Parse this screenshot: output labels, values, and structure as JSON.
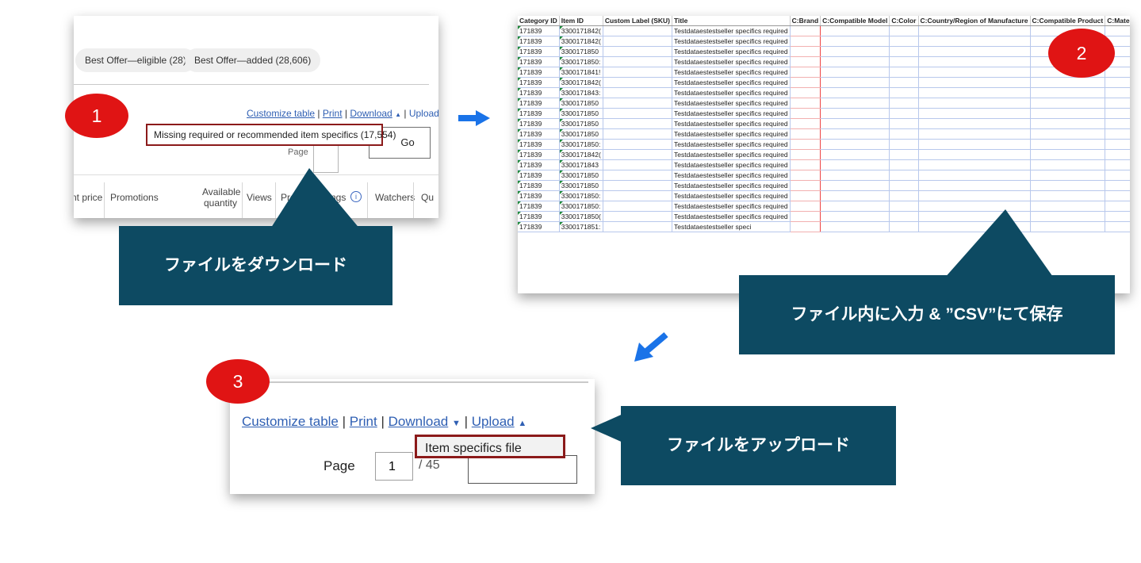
{
  "step1": {
    "badge": "1",
    "filters": {
      "best_offer_eligible": "Best Offer—eligible (28)",
      "best_offer_added": "Best Offer—added (28,606)"
    },
    "links": {
      "customize": "Customize table",
      "print": "Print",
      "download": "Download",
      "upload": "Upload",
      "sep": "|"
    },
    "dropdown_item": "Missing required or recommended item specifics (17,554)",
    "page_label": "Page",
    "go_label": "Go",
    "columns": {
      "price": "nt price",
      "promotions": "Promotions",
      "available_1": "Available",
      "available_2": "quantity",
      "views": "Views",
      "promoted": "Pro",
      "listings": "ngs",
      "watchers": "Watchers",
      "qty": "Qu"
    },
    "callout": "ファイルをダウンロード"
  },
  "step2": {
    "badge": "2",
    "headers": [
      "Category ID",
      "Item ID",
      "Custom Label (SKU)",
      "Title",
      "C:Brand",
      "C:Compatible Model",
      "C:Color",
      "C:Country/Region of Manufacture",
      "C:Compatible Product",
      "C:Material"
    ],
    "rows": [
      {
        "category": "171839",
        "item": "3300171842(",
        "title": "Testdataestestseller specifics required"
      },
      {
        "category": "171839",
        "item": "3300171842(",
        "title": "Testdataestestseller specifics required"
      },
      {
        "category": "171839",
        "item": "3300171850",
        "title": "Testdataestestseller specifics required"
      },
      {
        "category": "171839",
        "item": "3300171850:",
        "title": "Testdataestestseller specifics required"
      },
      {
        "category": "171839",
        "item": "3300171841!",
        "title": "Testdataestestseller specifics required"
      },
      {
        "category": "171839",
        "item": "3300171842(",
        "title": "Testdataestestseller specifics required"
      },
      {
        "category": "171839",
        "item": "3300171843:",
        "title": "Testdataestestseller specifics required"
      },
      {
        "category": "171839",
        "item": "3300171850",
        "title": "Testdataestestseller specifics required"
      },
      {
        "category": "171839",
        "item": "3300171850",
        "title": "Testdataestestseller specifics required"
      },
      {
        "category": "171839",
        "item": "3300171850",
        "title": "Testdataestestseller specifics required"
      },
      {
        "category": "171839",
        "item": "3300171850",
        "title": "Testdataestestseller specifics required"
      },
      {
        "category": "171839",
        "item": "3300171850:",
        "title": "Testdataestestseller specifics required"
      },
      {
        "category": "171839",
        "item": "3300171842(",
        "title": "Testdataestestseller specifics required"
      },
      {
        "category": "171839",
        "item": "3300171843",
        "title": "Testdataestestseller specifics required"
      },
      {
        "category": "171839",
        "item": "3300171850",
        "title": "Testdataestestseller specifics required"
      },
      {
        "category": "171839",
        "item": "3300171850",
        "title": "Testdataestestseller specifics required"
      },
      {
        "category": "171839",
        "item": "3300171850:",
        "title": "Testdataestestseller specifics required"
      },
      {
        "category": "171839",
        "item": "3300171850:",
        "title": "Testdataestestseller specifics required"
      },
      {
        "category": "171839",
        "item": "3300171850(",
        "title": "Testdataestestseller specifics required"
      },
      {
        "category": "171839",
        "item": "3300171851:",
        "title": "Testdataestestseller speci"
      }
    ],
    "callout": "ファイル内に入力 & ”CSV”にて保存"
  },
  "step3": {
    "badge": "3",
    "links": {
      "customize": "Customize table",
      "print": "Print",
      "download": "Download",
      "upload": "Upload",
      "sep": "|"
    },
    "dropdown_item": "Item specifics file",
    "page_label": "Page",
    "page_value": "1",
    "page_of": "/ 45",
    "callout": "ファイルをアップロード"
  },
  "colors": {
    "badge": "#e01414",
    "callout": "#0d4a62",
    "arrow": "#1a73e8",
    "link": "#2f5fb3",
    "highlight_border": "#8b1a1a"
  }
}
